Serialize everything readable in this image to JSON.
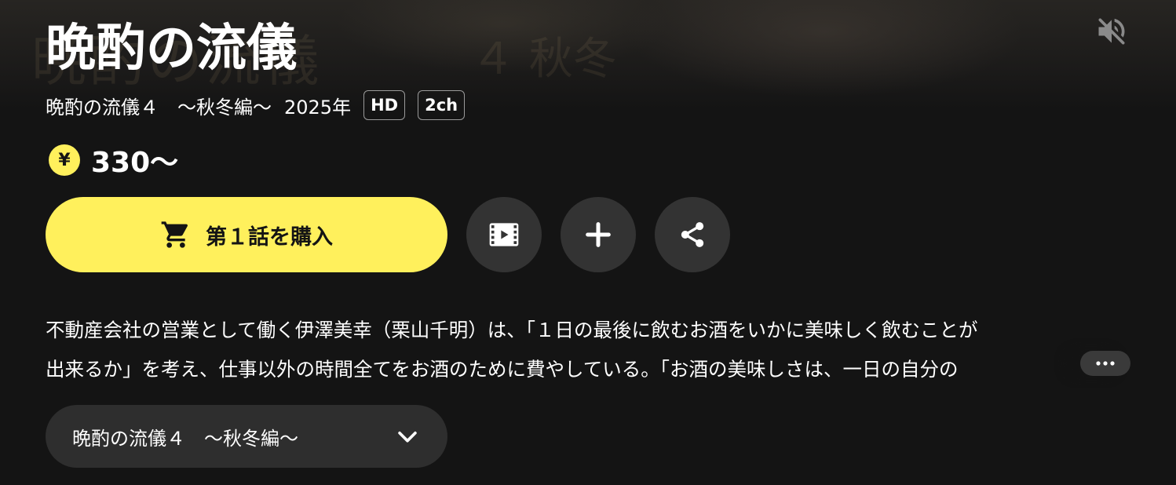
{
  "title": "晩酌の流儀",
  "meta": {
    "series_name": "晩酌の流儀４　～秋冬編～",
    "year": "2025年",
    "badges": [
      "HD",
      "2ch"
    ]
  },
  "price": {
    "currency_symbol": "¥",
    "amount": "330～"
  },
  "actions": {
    "buy_label": "第１話を購入",
    "icons": [
      "mute-icon",
      "cart-icon",
      "film-icon",
      "plus-icon",
      "share-icon",
      "more-dots-icon",
      "chevron-down-icon",
      "yen-icon"
    ]
  },
  "description": {
    "line1": "不動産会社の営業として働く伊澤美幸（栗山千明）は、「１日の最後に飲むお酒をいかに美味しく飲むことが",
    "line2": "出来るか」を考え、仕事以外の時間全てをお酒のために費やしている。「お酒の美味しさは、一日の自分の"
  },
  "season_selector": {
    "selected": "晩酌の流儀４　～秋冬編～"
  },
  "colors": {
    "accent": "#fff05c",
    "background": "#141414",
    "button_dark": "#333333",
    "selector_bg": "#2e2e2e"
  }
}
